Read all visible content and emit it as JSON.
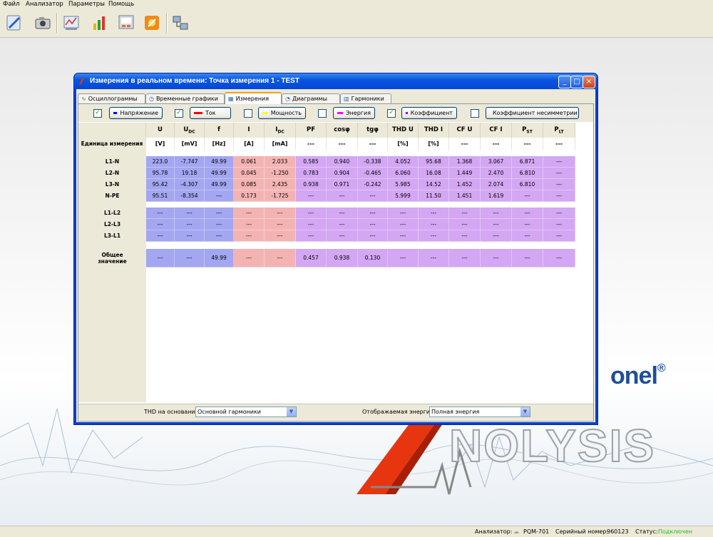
{
  "menu": [
    "Файл",
    "Анализатор",
    "Параметры",
    "Помощь"
  ],
  "toolbar_icons": [
    "connect-icon",
    "camera-icon",
    "analyze-icon",
    "bar-chart-icon",
    "settings-panel-icon",
    "tools-icon",
    "network-icon"
  ],
  "window": {
    "title": "Измерения в реальном времени: Точка измерения 1 - TEST"
  },
  "tabs": [
    {
      "label": "Осциллограммы",
      "icon": "oscillogram-icon"
    },
    {
      "label": "Временные графики",
      "icon": "time-graph-icon"
    },
    {
      "label": "Измерения",
      "icon": "measure-icon",
      "active": true
    },
    {
      "label": "Диаграммы",
      "icon": "diagram-icon"
    },
    {
      "label": "Гармоники",
      "icon": "harmonics-icon"
    }
  ],
  "filters": [
    {
      "label": "Напряжение",
      "checked": true,
      "color": "#0000ff"
    },
    {
      "label": "Ток",
      "checked": true,
      "color": "#ff0000"
    },
    {
      "label": "Мощность",
      "checked": false,
      "color": "#ffff00"
    },
    {
      "label": "Энергия",
      "checked": false,
      "color": "#ff00ff"
    },
    {
      "label": "Коэффициент",
      "checked": true,
      "color": "#8000ff"
    },
    {
      "label": "Коэффициент несимметрии",
      "checked": false,
      "color": "#00ff00"
    }
  ],
  "table": {
    "unit_label": "Единица измерения",
    "columns": [
      {
        "main": "U",
        "sub": "",
        "unit": "[V]"
      },
      {
        "main": "U",
        "sub": "DC",
        "unit": "[mV]"
      },
      {
        "main": "f",
        "sub": "",
        "unit": "[Hz]"
      },
      {
        "main": "I",
        "sub": "",
        "unit": "[A]"
      },
      {
        "main": "I",
        "sub": "DC",
        "unit": "[mA]"
      },
      {
        "main": "PF",
        "sub": "",
        "unit": "---"
      },
      {
        "main": "cosφ",
        "sub": "",
        "unit": "---"
      },
      {
        "main": "tgφ",
        "sub": "",
        "unit": "---"
      },
      {
        "main": "THD U",
        "sub": "",
        "unit": "[%]"
      },
      {
        "main": "THD I",
        "sub": "",
        "unit": "[%]"
      },
      {
        "main": "CF U",
        "sub": "",
        "unit": "---"
      },
      {
        "main": "CF I",
        "sub": "",
        "unit": "---"
      },
      {
        "main": "P",
        "sub": "ST",
        "unit": "---"
      },
      {
        "main": "P",
        "sub": "LT",
        "unit": "---"
      }
    ],
    "groups": [
      {
        "rows": [
          {
            "label": "L1-N",
            "values": [
              "223.0",
              "-7.747",
              "49.99",
              "0.061",
              "2.033",
              "0.585",
              "0.940",
              "-0.338",
              "4.052",
              "95.68",
              "1.368",
              "3.067",
              "6.871",
              "---"
            ]
          },
          {
            "label": "L2-N",
            "values": [
              "95.78",
              "19.18",
              "49.99",
              "0.045",
              "-1.250",
              "0.783",
              "0.904",
              "-0.465",
              "6.060",
              "16.08",
              "1.449",
              "2.470",
              "6.810",
              "---"
            ]
          },
          {
            "label": "L3-N",
            "values": [
              "95.42",
              "-4.307",
              "49.99",
              "0.085",
              "2.435",
              "0.938",
              "0.971",
              "-0.242",
              "5.985",
              "14.52",
              "1.452",
              "2.074",
              "6.810",
              "---"
            ]
          },
          {
            "label": "N-PE",
            "values": [
              "95.51",
              "-8.354",
              "---",
              "0.173",
              "-1.725",
              "---",
              "---",
              "---",
              "5.999",
              "11.50",
              "1.451",
              "1.619",
              "---",
              "---"
            ]
          }
        ]
      },
      {
        "rows": [
          {
            "label": "L1-L2",
            "values": [
              "---",
              "---",
              "---",
              "---",
              "---",
              "---",
              "---",
              "---",
              "---",
              "---",
              "---",
              "---",
              "---",
              "---"
            ]
          },
          {
            "label": "L2-L3",
            "values": [
              "---",
              "---",
              "---",
              "---",
              "---",
              "---",
              "---",
              "---",
              "---",
              "---",
              "---",
              "---",
              "---",
              "---"
            ]
          },
          {
            "label": "L3-L1",
            "values": [
              "---",
              "---",
              "---",
              "---",
              "---",
              "---",
              "---",
              "---",
              "---",
              "---",
              "---",
              "---",
              "---",
              "---"
            ]
          }
        ]
      },
      {
        "rows": [
          {
            "label": "Общее значение",
            "values": [
              "---",
              "---",
              "49.99",
              "---",
              "---",
              "0.457",
              "0.938",
              "0.130",
              "---",
              "---",
              "---",
              "---",
              "---",
              "---"
            ]
          }
        ]
      }
    ]
  },
  "bottom": {
    "thd_label": "THD на основании",
    "thd_value": "Основной гармоники",
    "energy_label": "Отображаемая энергия",
    "energy_value": "Полная энергия"
  },
  "brand": {
    "suffix": "onel",
    "mark": "®",
    "product": "NOLYSIS",
    "product_accent": "A"
  },
  "status": {
    "analyzer_label": "Анализатор:",
    "analyzer_value": "PQM-701",
    "serial_label": "Серийный номер:",
    "serial_value": "960123",
    "status_label": "Статус:",
    "status_value": "Подключен",
    "status_color": "#22c022"
  }
}
